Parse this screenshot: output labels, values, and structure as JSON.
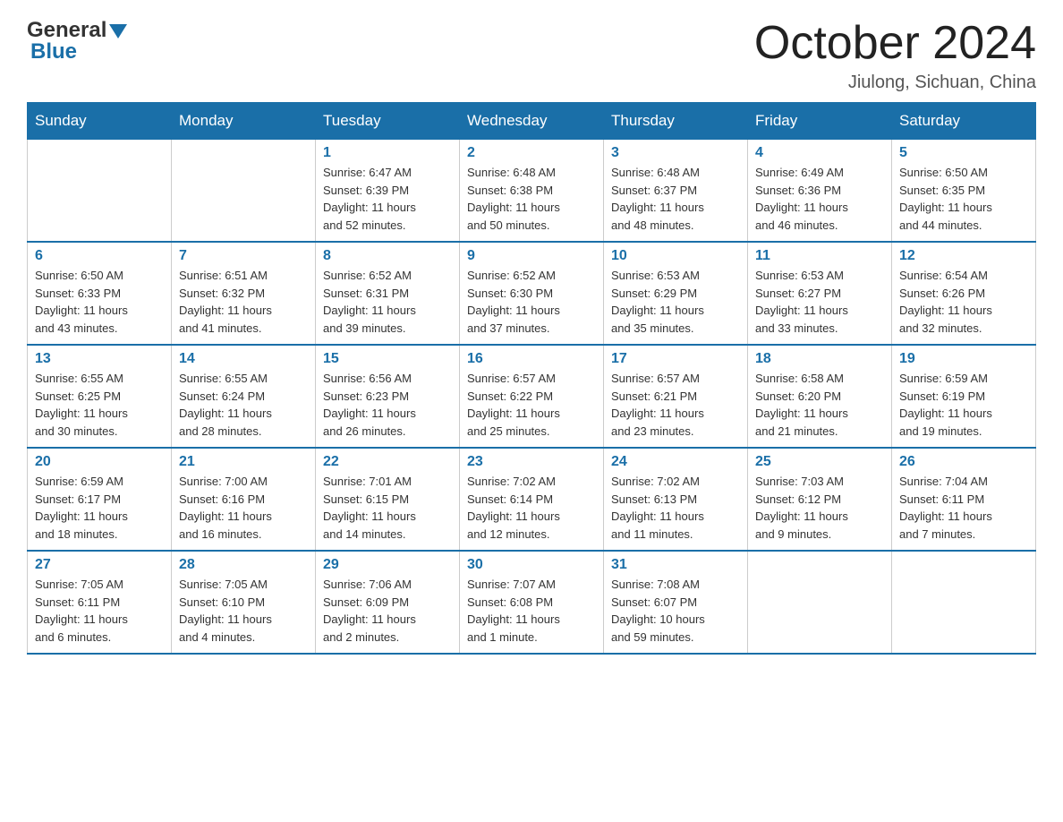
{
  "header": {
    "logo_general": "General",
    "logo_blue": "Blue",
    "month_title": "October 2024",
    "location": "Jiulong, Sichuan, China"
  },
  "weekdays": [
    "Sunday",
    "Monday",
    "Tuesday",
    "Wednesday",
    "Thursday",
    "Friday",
    "Saturday"
  ],
  "weeks": [
    [
      {
        "day": "",
        "info": ""
      },
      {
        "day": "",
        "info": ""
      },
      {
        "day": "1",
        "info": "Sunrise: 6:47 AM\nSunset: 6:39 PM\nDaylight: 11 hours\nand 52 minutes."
      },
      {
        "day": "2",
        "info": "Sunrise: 6:48 AM\nSunset: 6:38 PM\nDaylight: 11 hours\nand 50 minutes."
      },
      {
        "day": "3",
        "info": "Sunrise: 6:48 AM\nSunset: 6:37 PM\nDaylight: 11 hours\nand 48 minutes."
      },
      {
        "day": "4",
        "info": "Sunrise: 6:49 AM\nSunset: 6:36 PM\nDaylight: 11 hours\nand 46 minutes."
      },
      {
        "day": "5",
        "info": "Sunrise: 6:50 AM\nSunset: 6:35 PM\nDaylight: 11 hours\nand 44 minutes."
      }
    ],
    [
      {
        "day": "6",
        "info": "Sunrise: 6:50 AM\nSunset: 6:33 PM\nDaylight: 11 hours\nand 43 minutes."
      },
      {
        "day": "7",
        "info": "Sunrise: 6:51 AM\nSunset: 6:32 PM\nDaylight: 11 hours\nand 41 minutes."
      },
      {
        "day": "8",
        "info": "Sunrise: 6:52 AM\nSunset: 6:31 PM\nDaylight: 11 hours\nand 39 minutes."
      },
      {
        "day": "9",
        "info": "Sunrise: 6:52 AM\nSunset: 6:30 PM\nDaylight: 11 hours\nand 37 minutes."
      },
      {
        "day": "10",
        "info": "Sunrise: 6:53 AM\nSunset: 6:29 PM\nDaylight: 11 hours\nand 35 minutes."
      },
      {
        "day": "11",
        "info": "Sunrise: 6:53 AM\nSunset: 6:27 PM\nDaylight: 11 hours\nand 33 minutes."
      },
      {
        "day": "12",
        "info": "Sunrise: 6:54 AM\nSunset: 6:26 PM\nDaylight: 11 hours\nand 32 minutes."
      }
    ],
    [
      {
        "day": "13",
        "info": "Sunrise: 6:55 AM\nSunset: 6:25 PM\nDaylight: 11 hours\nand 30 minutes."
      },
      {
        "day": "14",
        "info": "Sunrise: 6:55 AM\nSunset: 6:24 PM\nDaylight: 11 hours\nand 28 minutes."
      },
      {
        "day": "15",
        "info": "Sunrise: 6:56 AM\nSunset: 6:23 PM\nDaylight: 11 hours\nand 26 minutes."
      },
      {
        "day": "16",
        "info": "Sunrise: 6:57 AM\nSunset: 6:22 PM\nDaylight: 11 hours\nand 25 minutes."
      },
      {
        "day": "17",
        "info": "Sunrise: 6:57 AM\nSunset: 6:21 PM\nDaylight: 11 hours\nand 23 minutes."
      },
      {
        "day": "18",
        "info": "Sunrise: 6:58 AM\nSunset: 6:20 PM\nDaylight: 11 hours\nand 21 minutes."
      },
      {
        "day": "19",
        "info": "Sunrise: 6:59 AM\nSunset: 6:19 PM\nDaylight: 11 hours\nand 19 minutes."
      }
    ],
    [
      {
        "day": "20",
        "info": "Sunrise: 6:59 AM\nSunset: 6:17 PM\nDaylight: 11 hours\nand 18 minutes."
      },
      {
        "day": "21",
        "info": "Sunrise: 7:00 AM\nSunset: 6:16 PM\nDaylight: 11 hours\nand 16 minutes."
      },
      {
        "day": "22",
        "info": "Sunrise: 7:01 AM\nSunset: 6:15 PM\nDaylight: 11 hours\nand 14 minutes."
      },
      {
        "day": "23",
        "info": "Sunrise: 7:02 AM\nSunset: 6:14 PM\nDaylight: 11 hours\nand 12 minutes."
      },
      {
        "day": "24",
        "info": "Sunrise: 7:02 AM\nSunset: 6:13 PM\nDaylight: 11 hours\nand 11 minutes."
      },
      {
        "day": "25",
        "info": "Sunrise: 7:03 AM\nSunset: 6:12 PM\nDaylight: 11 hours\nand 9 minutes."
      },
      {
        "day": "26",
        "info": "Sunrise: 7:04 AM\nSunset: 6:11 PM\nDaylight: 11 hours\nand 7 minutes."
      }
    ],
    [
      {
        "day": "27",
        "info": "Sunrise: 7:05 AM\nSunset: 6:11 PM\nDaylight: 11 hours\nand 6 minutes."
      },
      {
        "day": "28",
        "info": "Sunrise: 7:05 AM\nSunset: 6:10 PM\nDaylight: 11 hours\nand 4 minutes."
      },
      {
        "day": "29",
        "info": "Sunrise: 7:06 AM\nSunset: 6:09 PM\nDaylight: 11 hours\nand 2 minutes."
      },
      {
        "day": "30",
        "info": "Sunrise: 7:07 AM\nSunset: 6:08 PM\nDaylight: 11 hours\nand 1 minute."
      },
      {
        "day": "31",
        "info": "Sunrise: 7:08 AM\nSunset: 6:07 PM\nDaylight: 10 hours\nand 59 minutes."
      },
      {
        "day": "",
        "info": ""
      },
      {
        "day": "",
        "info": ""
      }
    ]
  ]
}
